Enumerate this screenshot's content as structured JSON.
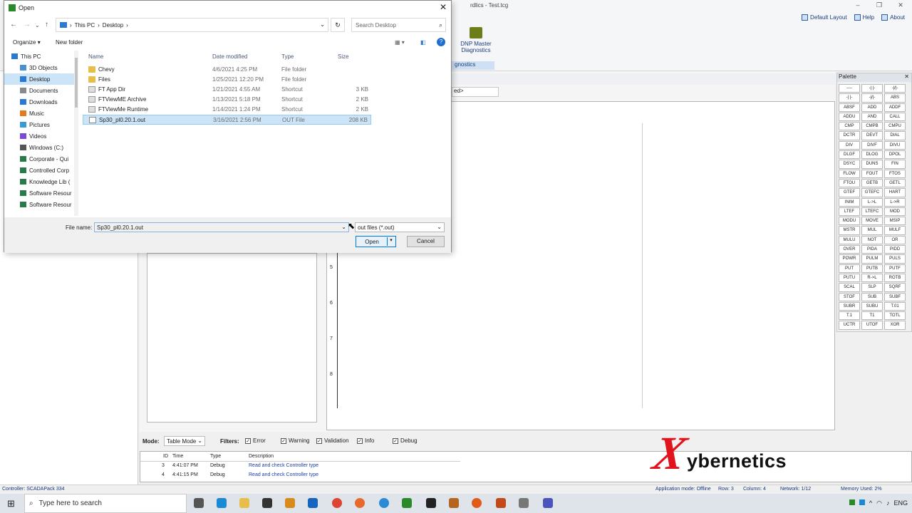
{
  "app": {
    "title": "rdlics - Test.tcg",
    "top_links": [
      "Default Layout",
      "Help",
      "About"
    ],
    "ribbon_button": "DNP Master\nDiagnostics",
    "ribbon_caption": "gnostics",
    "combo_text": "ed>",
    "ladder_rungs": [
      "5",
      "6",
      "7",
      "8"
    ]
  },
  "palette": {
    "title": "Palette",
    "items": [
      "----",
      "-| |-",
      "-|/|-",
      "-| |-",
      "-|/|-",
      "ABS",
      "ABSF",
      "ADD",
      "ADDF",
      "ADDU",
      "AND",
      "CALL",
      "CMP",
      "CMPB",
      "CMPU",
      "DCTR",
      "DEVT",
      "DIAL",
      "DIV",
      "DIVF",
      "DIVU",
      "DLGF",
      "DLOG",
      "DPOL",
      "DSYC",
      "DUNS",
      "FIN",
      "FLOW",
      "FOUT",
      "FTOS",
      "FTOU",
      "GETB",
      "GETL",
      "GTEF",
      "GTEFC",
      "HART",
      "INIM",
      "L->L",
      "L->R",
      "LTEF",
      "LTEFC",
      "MOD",
      "MODU",
      "MOVE",
      "MSIP",
      "MSTR",
      "MUL",
      "MULF",
      "MULU",
      "NOT",
      "OR",
      "OVER",
      "PIDA",
      "PIDD",
      "POWR",
      "PULM",
      "PULS",
      "PUT",
      "PUTB",
      "PUTF",
      "PUTU",
      "R->L",
      "ROTB",
      "SCAL",
      "SLP",
      "SQRF",
      "STOF",
      "SUB",
      "SUBF",
      "SUBR",
      "SUBU",
      "T.01",
      "T.1",
      "T1",
      "TOTL",
      "UCTR",
      "UTOF",
      "XOR"
    ]
  },
  "mode_bar": {
    "mode_label": "Mode:",
    "mode_value": "Table Mode",
    "filters_label": "Filters:",
    "filters": [
      "Error",
      "Warning",
      "Validation",
      "Info",
      "Debug"
    ]
  },
  "log": {
    "columns": [
      "ID",
      "Time",
      "Type",
      "Description"
    ],
    "rows": [
      {
        "id": "3",
        "time": "4:41:07 PM",
        "type": "Debug",
        "desc": "Read and check Controller type"
      },
      {
        "id": "4",
        "time": "4:41:15 PM",
        "type": "Debug",
        "desc": "Read and check Controller type"
      }
    ]
  },
  "brand": {
    "mark": "X",
    "text": "ybernetics",
    "color": "#e1141e"
  },
  "status": {
    "controller": "Controller: SCADAPack 334",
    "mode": "Application mode: Offline",
    "row": "Row: 3",
    "column": "Column: 4",
    "network": "Network: 1/12",
    "memory": "Memory Used: 2%"
  },
  "taskbar": {
    "search_placeholder": "Type here to search",
    "tray": "ENG"
  },
  "dialog": {
    "title": "Open",
    "breadcrumb": [
      "This PC",
      "Desktop"
    ],
    "search_placeholder": "Search Desktop",
    "organize": "Organize",
    "new_folder": "New folder",
    "tree": [
      "This PC",
      "3D Objects",
      "Desktop",
      "Documents",
      "Downloads",
      "Music",
      "Pictures",
      "Videos",
      "Windows (C:)",
      "Corporate - Qui",
      "Controlled Corp",
      "Knowledge Lib (",
      "Software Resour",
      "Software Resour"
    ],
    "tree_selected": "Desktop",
    "columns": [
      "Name",
      "Date modified",
      "Type",
      "Size"
    ],
    "files": [
      {
        "name": "Chevy",
        "date": "4/6/2021 4:25 PM",
        "type": "File folder",
        "size": "",
        "kind": "folder"
      },
      {
        "name": "Files",
        "date": "1/25/2021 12:20 PM",
        "type": "File folder",
        "size": "",
        "kind": "folder"
      },
      {
        "name": "FT App Dir",
        "date": "1/21/2021 4:55 AM",
        "type": "Shortcut",
        "size": "3 KB",
        "kind": "shortcut"
      },
      {
        "name": "FTViewME Archive",
        "date": "1/13/2021 5:18 PM",
        "type": "Shortcut",
        "size": "2 KB",
        "kind": "shortcut"
      },
      {
        "name": "FTViewMe Runtime",
        "date": "1/14/2021 1:24 PM",
        "type": "Shortcut",
        "size": "2 KB",
        "kind": "shortcut"
      },
      {
        "name": "Sp30_pl0.20.1.out",
        "date": "3/16/2021 2:56 PM",
        "type": "OUT File",
        "size": "208 KB",
        "kind": "outfile",
        "selected": true
      }
    ],
    "file_name_label": "File name:",
    "file_name_value": "Sp30_pl0.20.1.out",
    "filter_value": "out files (*.out)",
    "open_label": "Open",
    "cancel_label": "Cancel"
  }
}
